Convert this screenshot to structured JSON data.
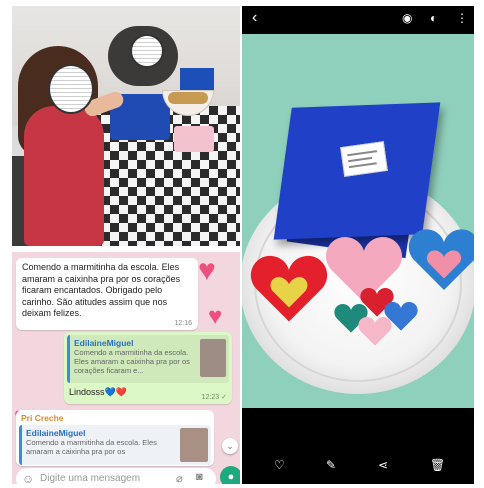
{
  "chat": {
    "message1": "Comendo a marmitinha da escola. Eles amaram a caixinha pra por os corações ficaram encantados. Obrigado pelo carinho. São atitudes assim que nos deixam felizes.",
    "message1_time": "12:16",
    "reply1": {
      "quoted_name": "EdilaineMiguel",
      "quoted_text": "Comendo a marmitinha da escola. Eles amaram a caixinha pra por os corações ficaram e...",
      "text": "Lindosss💙❤️",
      "time": "12:23 ✓"
    },
    "reply2": {
      "sender": "Pri Creche",
      "quoted_name": "EdilaineMiguel",
      "quoted_text": "Comendo a marmitinha da escola. Eles amaram a caixinha pra por os"
    },
    "input_placeholder": "Digite uma mensagem"
  },
  "viewer": {
    "top_icons": [
      "back-icon",
      "eye-icon",
      "nfc-icon",
      "more-icon"
    ],
    "bottom_icons": [
      "heart-icon",
      "edit-icon",
      "share-icon",
      "delete-icon"
    ]
  },
  "colors": {
    "whatsapp_green": "#1fa97f",
    "outgoing_bubble": "#dcf8c6",
    "chat_background": "#f2d7de",
    "box_blue": "#2140c8",
    "scene_mint": "#8fd0bc"
  }
}
